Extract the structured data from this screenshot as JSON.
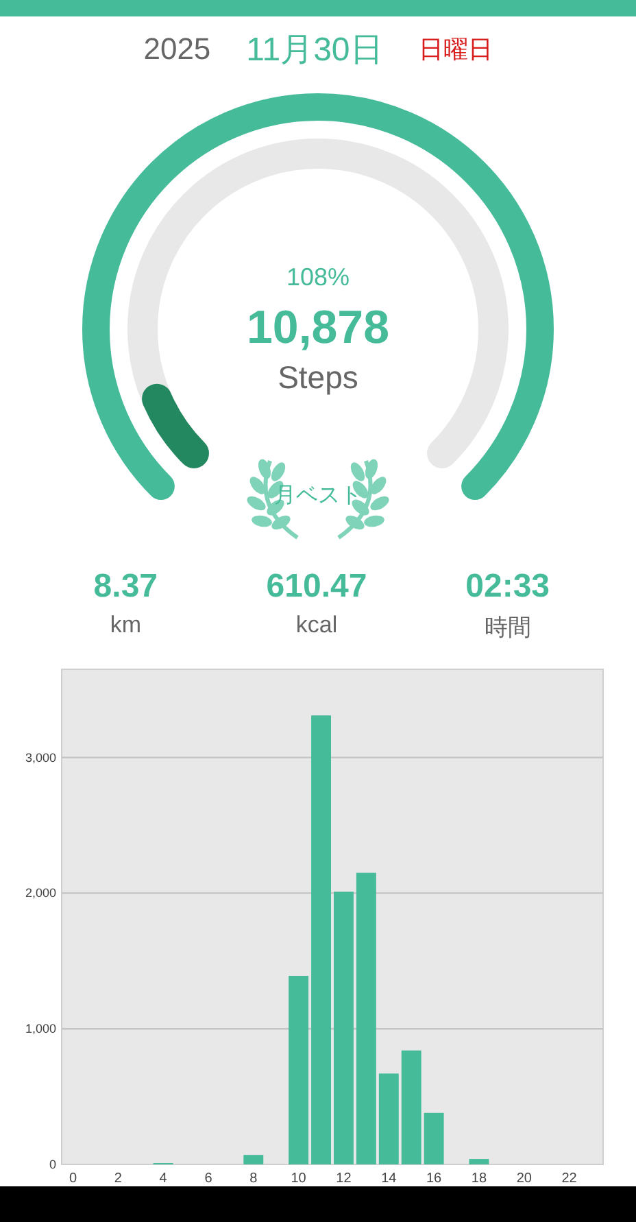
{
  "date": {
    "year": "2025",
    "day": "11月30日",
    "weekday": "日曜日"
  },
  "gauge": {
    "percent": "108%",
    "steps": "10,878",
    "unit": "Steps"
  },
  "badge": {
    "label": "月ベスト"
  },
  "stats": [
    {
      "value": "8.37",
      "label": "km"
    },
    {
      "value": "610.47",
      "label": "kcal"
    },
    {
      "value": "02:33",
      "label": "時間"
    }
  ],
  "hourly": {
    "chart_data": {
      "type": "bar",
      "x": [
        0,
        1,
        2,
        3,
        4,
        5,
        6,
        7,
        8,
        9,
        10,
        11,
        12,
        13,
        14,
        15,
        16,
        17,
        18,
        19,
        20,
        21,
        22,
        23
      ],
      "series": [
        {
          "color": "#45bb9a",
          "values": [
            0,
            0,
            0,
            0,
            10,
            0,
            0,
            0,
            70,
            0,
            1390,
            3310,
            2010,
            2150,
            670,
            840,
            380,
            0,
            40,
            0,
            0,
            0,
            0,
            0
          ]
        }
      ],
      "xlim": [
        -0.5,
        23.5
      ],
      "grid": true,
      "xticks": [
        0,
        2,
        4,
        6,
        8,
        10,
        12,
        14,
        16,
        18,
        20,
        22
      ],
      "yticks": [
        {
          "value": 0,
          "label": "0"
        },
        {
          "value": 1000,
          "label": "1,000"
        },
        {
          "value": 2000,
          "label": "2,000"
        },
        {
          "value": 3000,
          "label": "3,000"
        }
      ],
      "ylim": [
        0,
        3650
      ]
    }
  }
}
